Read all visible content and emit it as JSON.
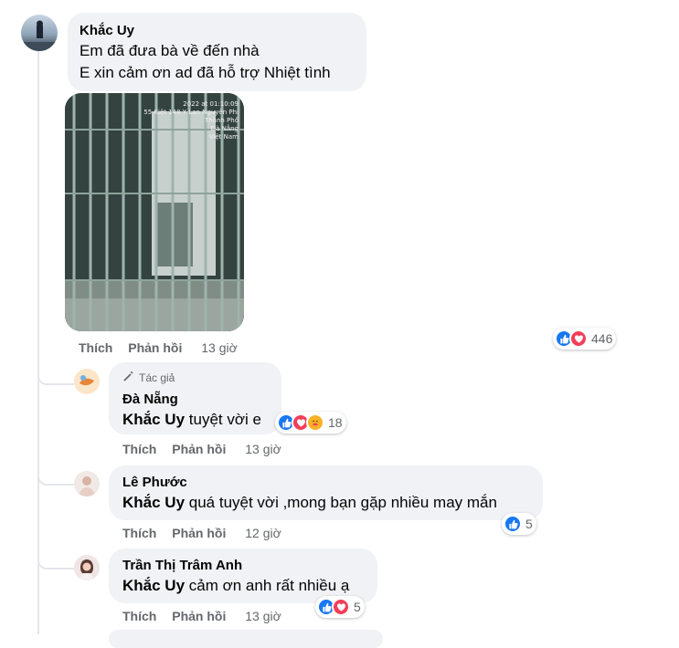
{
  "comment": {
    "author": "Khắc Uy",
    "lines": [
      "Em đã đưa bà về đến nhà",
      "E xin cảm ơn ad đã hỗ trợ Nhiệt tình"
    ],
    "photo_stamp": [
      "2022 at 01:10:09",
      "55 Kiệt 148 Y Lan Nguyên Phi",
      "Thành Phố",
      "Đà Nẵng",
      "Việt Nam"
    ],
    "like_label": "Thích",
    "reply_label": "Phản hồi",
    "time": "13 giờ",
    "reaction_count": "446"
  },
  "replies": [
    {
      "badge": "Tác giả",
      "author": "Đà Nẵng",
      "mention": "Khắc Uy",
      "text": "tuyệt vời e",
      "like_label": "Thích",
      "reply_label": "Phản hồi",
      "time": "13 giờ",
      "reaction_count": "18"
    },
    {
      "author": "Lê Phước",
      "mention": "Khắc Uy",
      "text": "quá tuyệt vời ,mong bạn gặp nhiều may mắn",
      "like_label": "Thích",
      "reply_label": "Phản hồi",
      "time": "12 giờ",
      "reaction_count": "5"
    },
    {
      "author": "Trần Thị Trâm Anh",
      "mention": "Khắc Uy",
      "text": "cảm ơn anh rất nhiều ạ",
      "like_label": "Thích",
      "reply_label": "Phản hồi",
      "time": "13 giờ",
      "reaction_count": "5"
    }
  ],
  "icons": {
    "like": "like-reaction-icon",
    "love": "love-reaction-icon",
    "care": "care-reaction-icon",
    "pencil": "pencil-icon"
  },
  "colors": {
    "bubble": "#f0f2f5",
    "like": "#1877f2",
    "love": "#f33e58",
    "care": "#f7b125",
    "meta": "#65676b"
  }
}
